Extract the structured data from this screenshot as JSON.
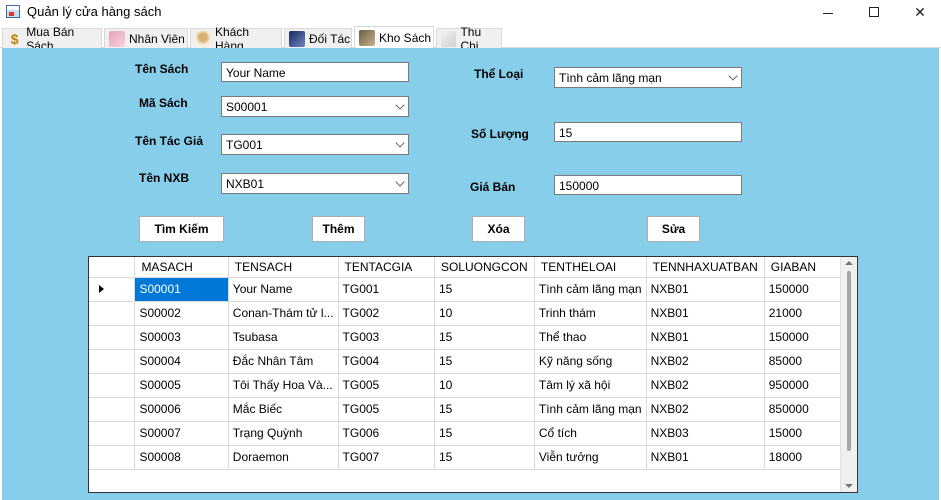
{
  "window": {
    "title": "Quản lý cửa hàng sách",
    "minimize": "—",
    "close": "✕"
  },
  "tabs": [
    {
      "label": "Mua Bán Sách",
      "icon": "dollar-icon"
    },
    {
      "label": "Nhân Viên",
      "icon": "staff-icon"
    },
    {
      "label": "Khách Hàng",
      "icon": "customer-icon"
    },
    {
      "label": "Đối Tác",
      "icon": "partner-icon"
    },
    {
      "label": "Kho Sách",
      "icon": "warehouse-icon",
      "active": true
    },
    {
      "label": "Thu Chi",
      "icon": "finance-icon"
    }
  ],
  "form": {
    "ten_sach_label": "Tên Sách",
    "ten_sach_value": "Your Name",
    "ma_sach_label": "Mã Sách",
    "ma_sach_value": "S00001",
    "tac_gia_label": "Tên Tác Giả",
    "tac_gia_value": "TG001",
    "nxb_label": "Tên NXB",
    "nxb_value": "NXB01",
    "the_loai_label": "Thể Loại",
    "the_loai_value": "Tình cảm lãng mạn",
    "so_luong_label": "Số Lượng",
    "so_luong_value": "15",
    "gia_ban_label": "Giá Bán",
    "gia_ban_value": "150000"
  },
  "buttons": {
    "search": "Tìm Kiếm",
    "add": "Thêm",
    "delete": "Xóa",
    "edit": "Sửa"
  },
  "grid": {
    "columns": [
      "MASACH",
      "TENSACH",
      "TENTACGIA",
      "SOLUONGCON",
      "TENTHELOAI",
      "TENNHAXUATBAN",
      "GIABAN"
    ],
    "rows": [
      [
        "S00001",
        "Your Name",
        "TG001",
        "15",
        "Tình cảm lãng mạn",
        "NXB01",
        "150000"
      ],
      [
        "S00002",
        "Conan-Thám tử l...",
        "TG002",
        "10",
        "Trinh thám",
        "NXB01",
        "21000"
      ],
      [
        "S00003",
        "Tsubasa",
        "TG003",
        "15",
        "Thể thao",
        "NXB01",
        "150000"
      ],
      [
        "S00004",
        "Đắc Nhân Tâm",
        "TG004",
        "15",
        "Kỹ năng sống",
        "NXB02",
        "85000"
      ],
      [
        "S00005",
        "Tôi Thấy Hoa Và...",
        "TG005",
        "10",
        "Tâm lý xã hội",
        "NXB02",
        "950000"
      ],
      [
        "S00006",
        "Mắc Biếc",
        "TG005",
        "15",
        "Tình cảm lãng mạn",
        "NXB02",
        "850000"
      ],
      [
        "S00007",
        "Trạng Quỳnh",
        "TG006",
        "15",
        "Cổ tích",
        "NXB03",
        "15000"
      ],
      [
        "S00008",
        "Doraemon",
        "TG007",
        "15",
        "Viễn tưởng",
        "NXB01",
        "18000"
      ]
    ]
  },
  "colors": {
    "panel_bg": "#87ceeb",
    "selection": "#0078d7"
  }
}
